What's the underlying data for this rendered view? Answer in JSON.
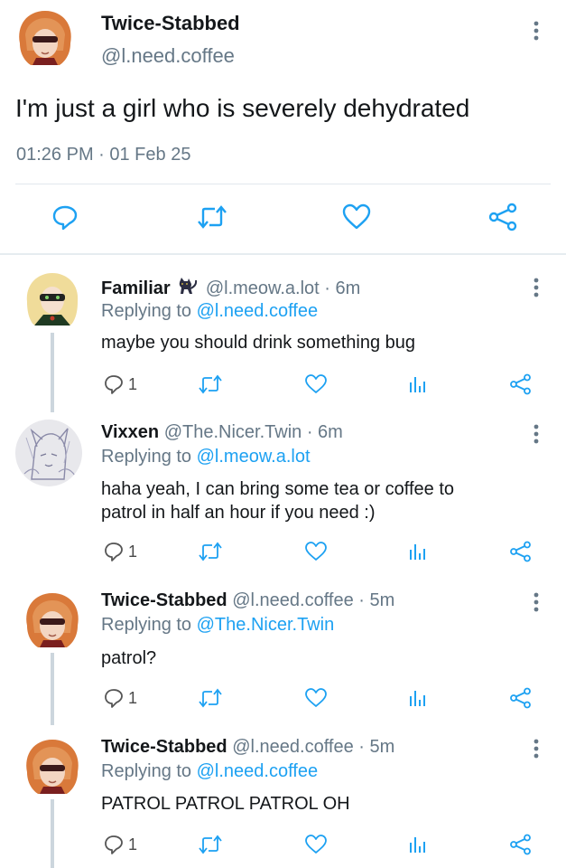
{
  "main_tweet": {
    "author_name": "Twice-Stabbed",
    "author_handle": "@l.need.coffee",
    "text": "I'm just a girl who is severely dehydrated",
    "timestamp": "01:26 PM · 01 Feb 25",
    "more_icon": "more-vertical-icon",
    "actions": [
      "reply-icon",
      "retweet-icon",
      "like-icon",
      "share-icon"
    ]
  },
  "replies": [
    {
      "name": "Familiar",
      "emoji": "cat-icon",
      "handle_time": "@l.meow.a.lot · 6m",
      "replying_label": "Replying to",
      "replying_to": "@l.need.coffee",
      "lines": [
        "maybe you should drink something bug"
      ],
      "reply_count": "1"
    },
    {
      "name": "Vixxen",
      "handle_time": "@The.Nicer.Twin · 6m",
      "replying_label": "Replying to",
      "replying_to": "@l.meow.a.lot",
      "lines": [
        "haha yeah, I can bring some tea or coffee to",
        "patrol in half an hour if you need :)"
      ],
      "reply_count": "1"
    },
    {
      "name": "Twice-Stabbed",
      "handle_time": "@l.need.coffee · 5m",
      "replying_label": "Replying to",
      "replying_to": "@The.Nicer.Twin",
      "lines": [
        "patrol?"
      ],
      "reply_count": "1"
    },
    {
      "name": "Twice-Stabbed",
      "handle_time": "@l.need.coffee · 5m",
      "replying_label": "Replying to",
      "replying_to": "@l.need.coffee",
      "lines": [
        "PATROL PATROL PATROL OH"
      ],
      "reply_count": "1"
    }
  ],
  "colors": {
    "link": "#1da1f2",
    "secondary_text": "#657786",
    "primary_text": "#14171a",
    "icon": "#1da1f2",
    "reply_icon": "#555555"
  }
}
